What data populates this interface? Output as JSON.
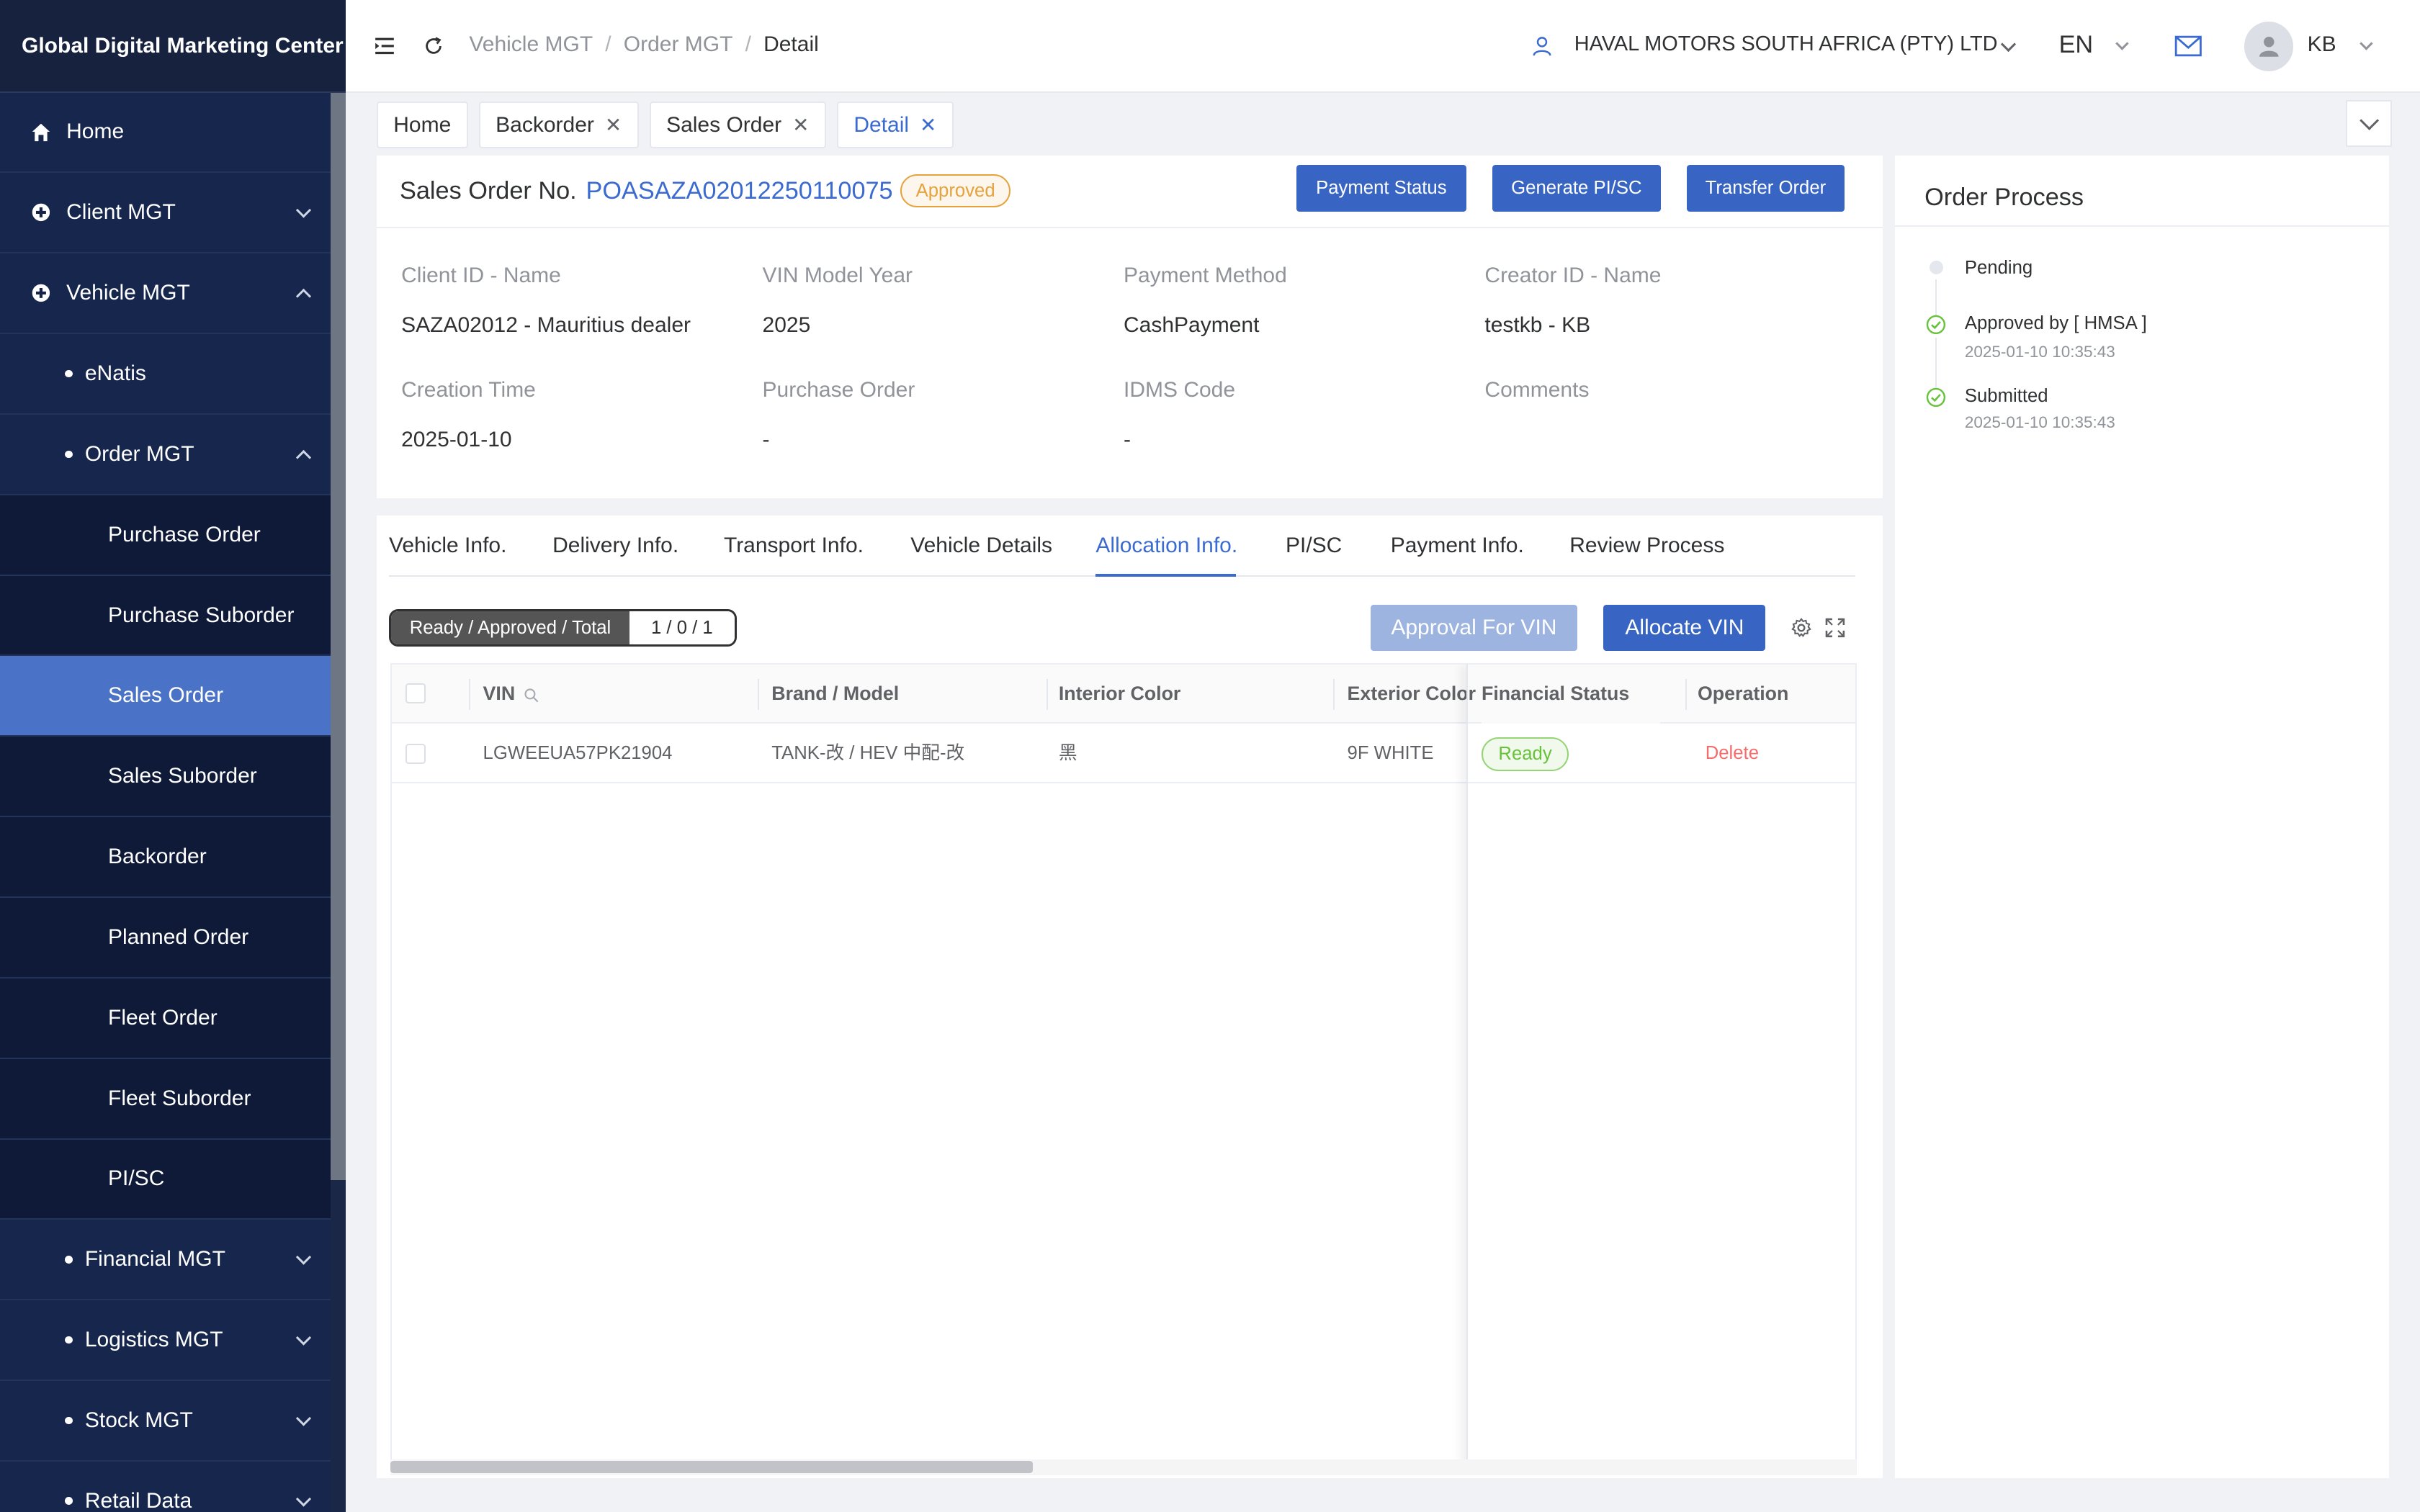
{
  "app": {
    "title": "Global Digital Marketing Center"
  },
  "sidebar": {
    "home": "Home",
    "client_mgt": "Client MGT",
    "vehicle_mgt": "Vehicle MGT",
    "enatis": "eNatis",
    "order_mgt": "Order MGT",
    "order_items": [
      "Purchase Order",
      "Purchase Suborder",
      "Sales Order",
      "Sales Suborder",
      "Backorder",
      "Planned Order",
      "Fleet Order",
      "Fleet Suborder",
      "PI/SC"
    ],
    "active_item": "Sales Order",
    "financial_mgt": "Financial MGT",
    "logistics_mgt": "Logistics MGT",
    "stock_mgt": "Stock MGT",
    "retail_data": "Retail Data"
  },
  "header": {
    "breadcrumb": [
      "Vehicle MGT",
      "Order MGT",
      "Detail"
    ],
    "separator": "/",
    "company": "HAVAL MOTORS SOUTH AFRICA (PTY) LTD",
    "language": "EN",
    "user_initials": "KB",
    "icons": [
      "menu-fold-icon",
      "refresh-icon",
      "user-icon",
      "mail-icon",
      "avatar-icon"
    ]
  },
  "tabs": [
    {
      "label": "Home",
      "closable": false,
      "active": false
    },
    {
      "label": "Backorder",
      "closable": true,
      "active": false
    },
    {
      "label": "Sales Order",
      "closable": true,
      "active": false
    },
    {
      "label": "Detail",
      "closable": true,
      "active": true
    }
  ],
  "order": {
    "label": "Sales Order No.",
    "number": "POASAZA02012250110075",
    "status": "Approved",
    "buttons": {
      "payment_status": "Payment Status",
      "generate_pisc": "Generate PI/SC",
      "transfer_order": "Transfer Order"
    },
    "fields": {
      "client_label": "Client ID - Name",
      "client_value": "SAZA02012 - Mauritius dealer",
      "vin_year_label": "VIN Model Year",
      "vin_year_value": "2025",
      "payment_method_label": "Payment Method",
      "payment_method_value": "CashPayment",
      "creator_label": "Creator ID - Name",
      "creator_value": "testkb - KB",
      "creation_time_label": "Creation Time",
      "creation_time_value": "2025-01-10",
      "purchase_order_label": "Purchase Order",
      "purchase_order_value": "-",
      "idms_label": "IDMS Code",
      "idms_value": "-",
      "comments_label": "Comments"
    }
  },
  "detail_tabs": [
    "Vehicle Info.",
    "Delivery Info.",
    "Transport Info.",
    "Vehicle Details",
    "Allocation Info.",
    "PI/SC",
    "Payment Info.",
    "Review Process"
  ],
  "active_detail_tab": "Allocation Info.",
  "allocation": {
    "counter_label": "Ready / Approved / Total",
    "counter_value": "1 / 0 / 1",
    "approval_button": "Approval For VIN",
    "allocate_button": "Allocate VIN",
    "columns": [
      "VIN",
      "Brand / Model",
      "Interior Color",
      "Exterior Color",
      "Financial Status",
      "Operation"
    ],
    "rows": [
      {
        "vin": "LGWEEUA57PK21904",
        "brand_model": "TANK-改 / HEV 中配-改",
        "interior": "黑",
        "exterior": "9F WHITE",
        "financial_status": "Ready",
        "operation": "Delete"
      }
    ]
  },
  "order_process": {
    "title": "Order Process",
    "steps": [
      {
        "label": "Pending",
        "time": ""
      },
      {
        "label": "Approved by [ HMSA ]",
        "time": "2025-01-10 10:35:43"
      },
      {
        "label": "Submitted",
        "time": "2025-01-10 10:35:43"
      }
    ]
  },
  "colors": {
    "sidebar_bg": "#162447",
    "sidebar_active": "#4a72c6",
    "primary": "#3865c4",
    "link": "#3b6bd1",
    "warning": "#e6a23c",
    "success": "#67c23a",
    "danger": "#f56c6c"
  }
}
